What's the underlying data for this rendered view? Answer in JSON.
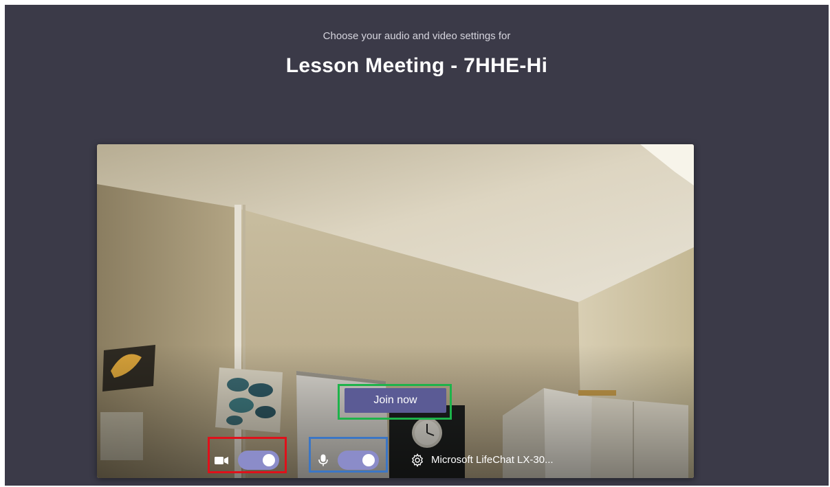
{
  "header": {
    "subtitle": "Choose your audio and video settings for",
    "meeting_title": "Lesson Meeting - 7HHE-Hi"
  },
  "preview": {
    "join_label": "Join now",
    "controls": {
      "camera_icon": "video-camera-icon",
      "camera_on": true,
      "mic_icon": "microphone-icon",
      "mic_on": true,
      "settings_icon": "gear-icon",
      "device_label": "Microsoft LifeChat LX-30..."
    }
  },
  "colors": {
    "background": "#3b3a48",
    "accent": "#5b5b95",
    "toggle_on": "#8b8cc9",
    "highlight_join": "#1db34a",
    "highlight_camera": "#e0101a",
    "highlight_mic": "#3b76c5"
  }
}
